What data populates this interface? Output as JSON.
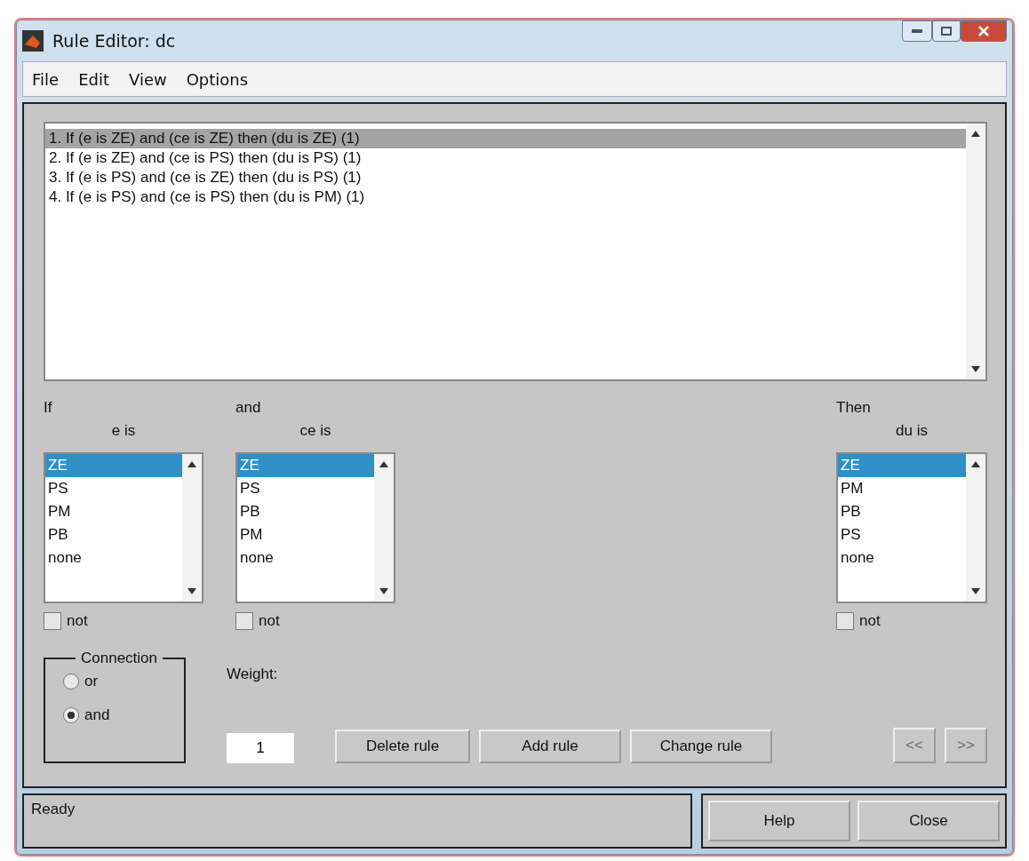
{
  "window": {
    "title": "Rule Editor: dc"
  },
  "menu": [
    "File",
    "Edit",
    "View",
    "Options"
  ],
  "rules": [
    {
      "text": "1. If (e is ZE) and (ce is ZE) then (du is ZE) (1)",
      "selected": true
    },
    {
      "text": "2. If (e is ZE) and (ce is PS) then (du is PS) (1)",
      "selected": false
    },
    {
      "text": "3. If (e is PS) and (ce is ZE) then (du is PS) (1)",
      "selected": false
    },
    {
      "text": "4. If (e is PS) and (ce is PS) then (du is PM) (1)",
      "selected": false
    }
  ],
  "inputs": [
    {
      "heading": "If",
      "variable": "e is",
      "options": [
        {
          "label": "ZE",
          "selected": true
        },
        {
          "label": "PS",
          "selected": false
        },
        {
          "label": "PM",
          "selected": false
        },
        {
          "label": "PB",
          "selected": false
        },
        {
          "label": "none",
          "selected": false
        }
      ],
      "not": {
        "label": "not",
        "checked": false
      }
    },
    {
      "heading": "and",
      "variable": "ce is",
      "options": [
        {
          "label": "ZE",
          "selected": true
        },
        {
          "label": "PS",
          "selected": false
        },
        {
          "label": "PB",
          "selected": false
        },
        {
          "label": "PM",
          "selected": false
        },
        {
          "label": "none",
          "selected": false
        }
      ],
      "not": {
        "label": "not",
        "checked": false
      }
    }
  ],
  "output": {
    "heading": "Then",
    "variable": "du is",
    "options": [
      {
        "label": "ZE",
        "selected": true
      },
      {
        "label": "PM",
        "selected": false
      },
      {
        "label": "PB",
        "selected": false
      },
      {
        "label": "PS",
        "selected": false
      },
      {
        "label": "none",
        "selected": false
      }
    ],
    "not": {
      "label": "not",
      "checked": false
    }
  },
  "connection": {
    "title": "Connection",
    "options": [
      {
        "label": "or",
        "selected": false
      },
      {
        "label": "and",
        "selected": true
      }
    ]
  },
  "weight": {
    "label": "Weight:",
    "value": "1"
  },
  "buttons": [
    {
      "label": "Delete rule",
      "disabled": false
    },
    {
      "label": "Add rule",
      "disabled": false
    },
    {
      "label": "Change rule",
      "disabled": false
    }
  ],
  "nav_buttons": [
    {
      "label": "<<",
      "disabled": true
    },
    {
      "label": ">>",
      "disabled": true
    }
  ],
  "status": "Ready",
  "footer_buttons": [
    "Help",
    "Close"
  ]
}
